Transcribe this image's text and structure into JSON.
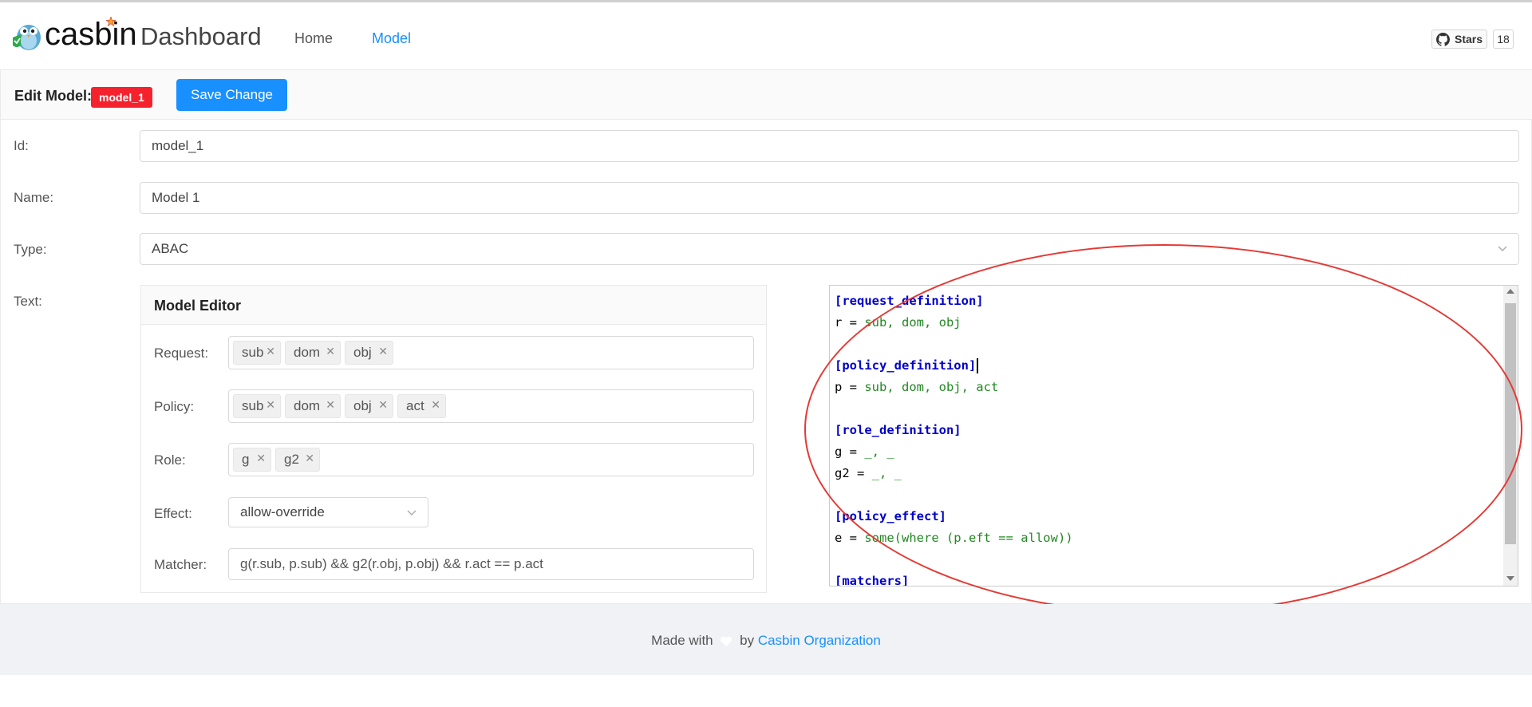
{
  "brand": {
    "name": "casbin",
    "subtitle": "Dashboard"
  },
  "nav": [
    {
      "label": "Home",
      "active": false
    },
    {
      "label": "Model",
      "active": true
    }
  ],
  "github": {
    "stars_label": "Stars",
    "stars_count": "18"
  },
  "toolbar": {
    "edit_label": "Edit Model:",
    "model_tag": "model_1",
    "save_label": "Save Change"
  },
  "form": {
    "id": {
      "label": "Id:",
      "value": "model_1"
    },
    "name": {
      "label": "Name:",
      "value": "Model 1"
    },
    "type": {
      "label": "Type:",
      "value": "ABAC"
    },
    "text": {
      "label": "Text:"
    }
  },
  "editor": {
    "title": "Model Editor",
    "request": {
      "label": "Request:",
      "tags": [
        "sub",
        "dom",
        "obj"
      ]
    },
    "policy": {
      "label": "Policy:",
      "tags": [
        "sub",
        "dom",
        "obj",
        "act"
      ]
    },
    "role": {
      "label": "Role:",
      "tags": [
        "g",
        "g2"
      ]
    },
    "effect": {
      "label": "Effect:",
      "value": "allow-override"
    },
    "matcher": {
      "label": "Matcher:",
      "value": "g(r.sub, p.sub) && g2(r.obj, p.obj) && r.act == p.act"
    }
  },
  "code": {
    "lines": [
      {
        "section": "[request_definition]"
      },
      {
        "key": "r = ",
        "value": "sub, dom, obj"
      },
      {
        "blank": true
      },
      {
        "section": "[policy_definition]",
        "cursor": true
      },
      {
        "key": "p = ",
        "value": "sub, dom, obj, act"
      },
      {
        "blank": true
      },
      {
        "section": "[role_definition]"
      },
      {
        "key": "g = ",
        "value": "_, _"
      },
      {
        "key": "g2 = ",
        "value": "_, _"
      },
      {
        "blank": true
      },
      {
        "section": "[policy_effect]"
      },
      {
        "key": "e = ",
        "value": "some(where (p.eft == allow))"
      },
      {
        "blank": true
      },
      {
        "section": "[matchers]"
      }
    ]
  },
  "footer": {
    "prefix": "Made with",
    "by": "by",
    "link": "Casbin Organization"
  },
  "colors": {
    "accent": "#1890ff",
    "tag_red": "#f5222d",
    "annotation": "#e53935",
    "section": "#0000cc",
    "value": "#228822"
  }
}
